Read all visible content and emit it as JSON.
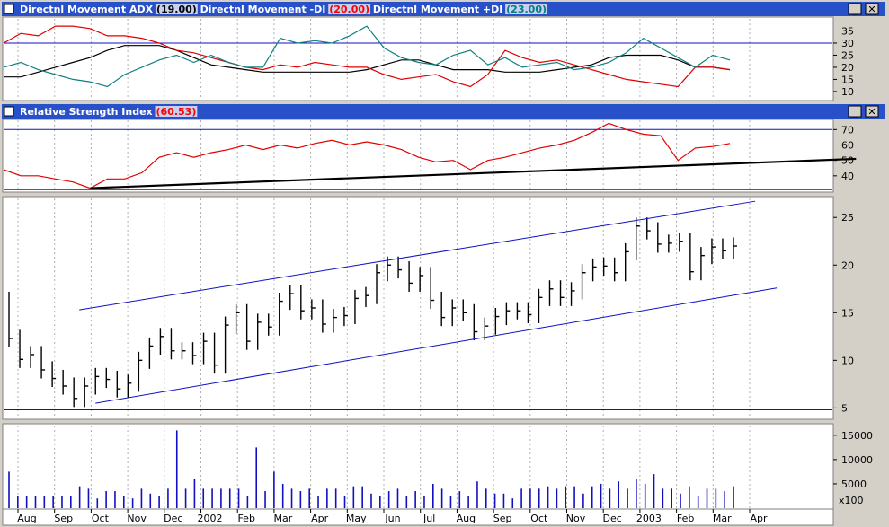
{
  "colors": {
    "titlebar": "#2850c8",
    "panel_bg": "#ffffff",
    "frame": "#d4d0c8",
    "adx": "#000000",
    "minus_di": "#e00000",
    "plus_di": "#108080",
    "rsi": "#e00000",
    "channel": "#1010c0",
    "volume": "#1010c0",
    "bars": "#000000",
    "value_red": "#ff0000",
    "value_black": "#000000",
    "value_teal": "#008080"
  },
  "window_buttons": {
    "minimize": "_",
    "close": "✕"
  },
  "panels": {
    "dmi": {
      "title_parts": [
        {
          "text": "Directnl Movement ADX ",
          "color": "#ffffff"
        },
        {
          "text": "(19.00)",
          "color": "#000000",
          "boxed": true
        },
        {
          "text": " Directnl Movement -DI ",
          "color": "#ffffff"
        },
        {
          "text": "(20.00)",
          "color": "#ff0000",
          "boxed": true
        },
        {
          "text": " Directnl Movement +DI ",
          "color": "#ffffff"
        },
        {
          "text": "(23.00)",
          "color": "#008080",
          "boxed": true
        }
      ]
    },
    "rsi": {
      "title_parts": [
        {
          "text": "Relative Strength Index ",
          "color": "#ffffff"
        },
        {
          "text": "(60.53)",
          "color": "#ff0000",
          "boxed": true
        }
      ]
    }
  },
  "volume_multiplier": "x100",
  "x_labels": [
    "Aug",
    "Sep",
    "Oct",
    "Nov",
    "Dec",
    "2002",
    "Feb",
    "Mar",
    "Apr",
    "May",
    "Jun",
    "Jul",
    "Aug",
    "Sep",
    "Oct",
    "Nov",
    "Dec",
    "2003",
    "Feb",
    "Mar",
    "Apr"
  ],
  "chart_data": [
    {
      "type": "line",
      "ylim": [
        7,
        40
      ],
      "yticks": [
        10,
        15,
        20,
        25,
        30,
        35
      ],
      "hlines": [
        30
      ],
      "series": [
        {
          "name": "Directnl Movement ADX",
          "values": [
            16,
            16,
            18,
            20,
            22,
            24,
            27,
            29,
            29,
            29,
            27,
            24,
            21,
            20,
            19,
            18,
            18,
            18,
            18,
            18,
            18,
            19,
            21,
            23,
            23,
            21,
            19,
            19,
            19,
            18,
            18,
            18,
            19,
            20,
            21,
            24,
            25,
            25,
            25,
            23,
            20,
            20,
            19
          ]
        },
        {
          "name": "Directnl Movement -DI",
          "values": [
            30,
            34,
            33,
            37,
            37,
            36,
            33,
            33,
            32,
            30,
            27,
            26,
            24,
            22,
            20,
            19,
            21,
            20,
            22,
            21,
            20,
            20,
            17,
            15,
            16,
            17,
            14,
            12,
            17,
            27,
            24,
            22,
            23,
            21,
            19,
            17,
            15,
            14,
            13,
            12,
            20,
            20,
            19
          ]
        },
        {
          "name": "Directnl Movement +DI",
          "values": [
            20,
            22,
            19,
            17,
            15,
            14,
            12,
            17,
            20,
            23,
            25,
            22,
            25,
            22,
            20,
            20,
            32,
            30,
            31,
            30,
            33,
            37,
            28,
            24,
            22,
            21,
            25,
            27,
            21,
            24,
            20,
            21,
            22,
            19,
            20,
            22,
            26,
            32,
            28,
            24,
            20,
            25,
            23
          ]
        }
      ]
    },
    {
      "type": "line",
      "ylim": [
        30,
        76
      ],
      "yticks": [
        40,
        50,
        60,
        70
      ],
      "hlines": [
        70,
        31
      ],
      "series": [
        {
          "name": "Relative Strength Index",
          "values": [
            44,
            40,
            40,
            38,
            36,
            32,
            38,
            38,
            42,
            52,
            55,
            52,
            55,
            57,
            60,
            57,
            60,
            58,
            61,
            63,
            60,
            62,
            60,
            57,
            52,
            49,
            50,
            44,
            50,
            52,
            55,
            58,
            60,
            63,
            68,
            74,
            70,
            67,
            66,
            50,
            58,
            59,
            61
          ]
        },
        {
          "name": "trendline",
          "x": [
            8,
            72
          ],
          "values": [
            32,
            51
          ]
        }
      ]
    },
    {
      "type": "ohlc",
      "ylim": [
        4,
        27
      ],
      "yticks": [
        5,
        10,
        15,
        20,
        25
      ],
      "hlines": [
        4.8
      ],
      "close": [
        12.3,
        10.1,
        10.6,
        9.0,
        8.1,
        7.3,
        6.0,
        7.3,
        8.3,
        8.0,
        7.0,
        7.6,
        10.0,
        11.5,
        12.5,
        11.0,
        11.0,
        10.5,
        12.0,
        9.5,
        13.7,
        15.0,
        12.0,
        14.0,
        13.5,
        16.2,
        17.0,
        15.2,
        15.5,
        13.8,
        14.5,
        14.7,
        16.5,
        16.8,
        19.2,
        20.0,
        19.5,
        18.1,
        18.9,
        16.3,
        14.5,
        15.5,
        15.0,
        13.0,
        13.6,
        14.6,
        15.2,
        15.2,
        14.8,
        16.6,
        17.5,
        16.6,
        17.3,
        19.2,
        19.8,
        19.9,
        19.2,
        21.4,
        24.1,
        23.6,
        22.2,
        22.3,
        22.5,
        19.3,
        21.0,
        21.9,
        21.5,
        22.0
      ],
      "channel_lines": [
        {
          "x": [
            6.5,
            69
          ],
          "values": [
            15.3,
            26.7
          ]
        },
        {
          "x": [
            8,
            71
          ],
          "values": [
            5.5,
            17.6
          ]
        }
      ]
    },
    {
      "type": "bar",
      "ylim": [
        0,
        17000
      ],
      "yticks": [
        5000,
        10000,
        15000
      ],
      "values": [
        7500,
        2500,
        2500,
        2500,
        2500,
        2500,
        2500,
        2500,
        4500,
        4000,
        2000,
        3500,
        3500,
        2500,
        2000,
        4000,
        3000,
        2500,
        4000,
        16000,
        4000,
        6000,
        4000,
        4000,
        4000,
        4000,
        4000,
        2500,
        12500,
        3500,
        7500,
        5000,
        4000,
        3500,
        4000,
        2500,
        4000,
        4000,
        2500,
        4500,
        4500,
        3000,
        2500,
        3500,
        4000,
        2500,
        3500,
        2500,
        5000,
        4000,
        2500,
        3500,
        2500,
        5500,
        4000,
        3000,
        3000,
        2000,
        4000,
        4000,
        4000,
        4500,
        4000,
        4500,
        4500,
        3000,
        4500,
        5000,
        4000,
        5500,
        4000,
        6000,
        5000,
        7000,
        4000,
        4000,
        3000,
        4500,
        2500,
        4000,
        4000,
        3500,
        4500
      ]
    }
  ]
}
